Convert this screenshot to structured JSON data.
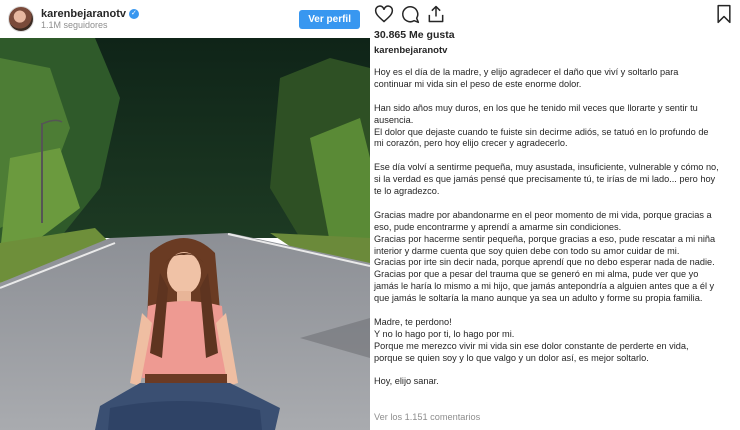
{
  "post": {
    "username": "karenbejaranotv",
    "followers": "1.1M seguidores",
    "follow_label": "Ver perfil",
    "likes": "30.865 Me gusta",
    "comments_link": "Ver los 1.151 comentarios"
  },
  "icons": {
    "verified": "verified-badge-icon",
    "like": "heart-icon",
    "comment": "comment-icon",
    "share": "share-icon",
    "save": "bookmark-icon"
  },
  "colors": {
    "accent": "#3897f0",
    "text": "#262626",
    "muted": "#8e8e8e"
  },
  "caption": {
    "paragraphs": [
      "Hoy es el día de la madre, y elijo agradecer el daño que viví y soltarlo para\ncontinuar mi vida sin el peso de este enorme dolor.",
      "Han sido años muy duros, en los que he tenido mil veces que llorarte y sentir tu\nausencia.\nEl dolor que dejaste cuando te fuiste sin decirme adiós, se tatuó en lo profundo de\nmi corazón, pero hoy elijo crecer y agradecerlo.",
      "Ese día volví a sentirme pequeña, muy asustada, insuficiente, vulnerable y cómo no,\nsi la verdad es que jamás pensé que precisamente tú, te irías de mi lado... pero hoy\nte lo agradezco.",
      "Gracias madre por abandonarme en el peor momento de mi vida, porque gracias a\neso, pude encontrarme y aprendí a amarme sin condiciones.\nGracias por hacerme sentir pequeña, porque gracias a eso, pude rescatar a mi niña\ninterior y darme cuenta que soy quien debe con todo su amor cuidar de mi.\nGracias por irte sin decir nada, porque aprendí que no debo esperar nada de nadie.\nGracias por que a pesar del trauma que se generó en mi alma, pude ver que yo\njamás le haría lo mismo a mi hijo, que jamás antepondría a alguien antes que a él y\nque jamás le soltaría la mano aunque ya sea un adulto y forme su propia familia.",
      "Madre, te perdono!\nY no lo hago por ti, lo hago por mi.\nPorque me merezco vivir mi vida sin ese dolor constante de perderte en vida,\nporque se quien soy y lo que valgo y un dolor así, es mejor soltarlo.",
      "Hoy, elijo sanar."
    ]
  }
}
